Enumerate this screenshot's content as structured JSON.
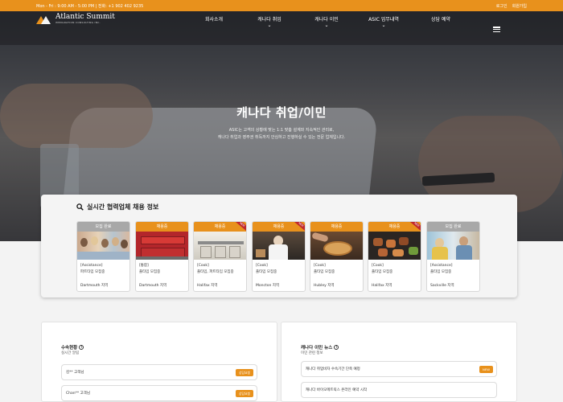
{
  "topbar": {
    "hours": "Mon - Fri : 9:00 AM - 5:00 PM  |  전화: +1 902 402 9235",
    "login": "로그인",
    "signup": "회원가입"
  },
  "brand": {
    "name": "Atlantic Summit",
    "tagline": "IMMIGRATION CONSULTING INC."
  },
  "nav": {
    "items": [
      {
        "label": "회사소개",
        "dropdown": false
      },
      {
        "label": "캐나다 취업",
        "dropdown": true
      },
      {
        "label": "캐나다 이민",
        "dropdown": true
      },
      {
        "label": "ASIC 업무내역",
        "dropdown": true
      },
      {
        "label": "상담 예약",
        "dropdown": false
      }
    ]
  },
  "hero": {
    "title": "캐나다 취업/이민",
    "line1": "ASIC는 고객의 상황에 맞는 1:1 맞춤 설계와 지속적인 관리로,",
    "line2": "캐나다 취업과 영주권 취득까지 안심하고 진행하실 수 있는 전문 업체입니다."
  },
  "jobs": {
    "heading": "실시간 협력업체 채용 정보",
    "cards": [
      {
        "status": "모집 완료",
        "closed": true,
        "new": false,
        "type": "[Assistance]",
        "job": "파트타임 모집중",
        "location": "Dartmouth 지역"
      },
      {
        "status": "채용중",
        "closed": false,
        "new": false,
        "type": "[통합]",
        "job": "풀타임 모집중",
        "location": "Dartmouth 지역"
      },
      {
        "status": "채용중",
        "closed": false,
        "new": true,
        "type": "[Cook]",
        "job": "풀타임, 파트타임 모집중",
        "location": "Halifax 지역"
      },
      {
        "status": "채용중",
        "closed": false,
        "new": true,
        "type": "[Cook]",
        "job": "풀타임 모집중",
        "location": "Moncton 지역"
      },
      {
        "status": "채용중",
        "closed": false,
        "new": false,
        "type": "[Cook]",
        "job": "풀타임 모집중",
        "location": "Hubley 지역"
      },
      {
        "status": "채용중",
        "closed": false,
        "new": true,
        "type": "[Cook]",
        "job": "풀타임 모집중",
        "location": "Halifax 지역"
      },
      {
        "status": "모집 완료",
        "closed": true,
        "new": false,
        "type": "[Assistance]",
        "job": "풀타임 모집중",
        "location": "Sackville 지역"
      }
    ],
    "new_label": "NEW"
  },
  "progress": {
    "title": "수속현황",
    "subtitle": "실시간 알림",
    "rows": [
      {
        "name": "김** 고객님",
        "tag": "상담요청"
      },
      {
        "name": "Chan** 고객님",
        "tag": "상담요청"
      }
    ]
  },
  "news": {
    "title": "캐나다 이민 뉴스",
    "subtitle": "이민 관련 정보",
    "rows": [
      {
        "text": "캐나다 취업비자 수속기간 단축 예정",
        "tag": "NEW"
      },
      {
        "text": "캐나다 바이오메트릭스 온라인 예약 시작",
        "tag": ""
      }
    ]
  },
  "colors": {
    "accent": "#e8911c",
    "closed": "#a8a8a8",
    "ribbon": "#c0282d"
  }
}
